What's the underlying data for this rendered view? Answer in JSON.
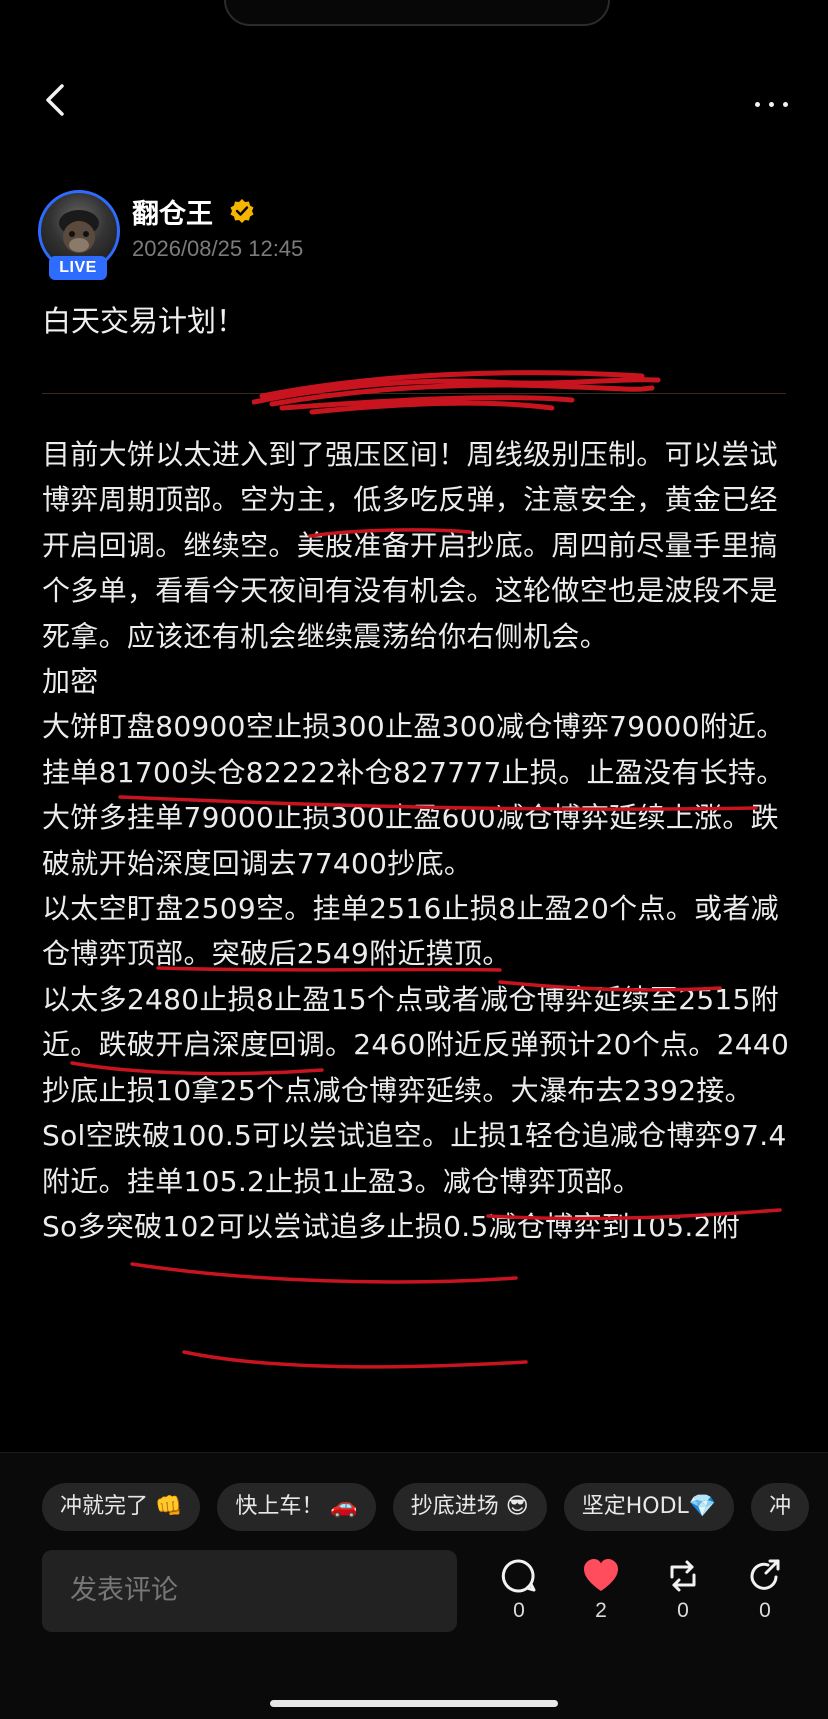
{
  "nav": {
    "back_icon": "chevron-left-icon",
    "more_icon": "more-dots-icon"
  },
  "author": {
    "name": "翻仓王",
    "badge": "LIVE",
    "timestamp": "2026/08/25 12:45",
    "verified_icon": "verified-badge-icon",
    "verified_color": "#f4b400",
    "avatar_ring_color": "#2e6bff"
  },
  "post": {
    "title": "白天交易计划！",
    "paragraphs": [
      "目前大饼以太进入到了强压区间！周线级别压制。可以尝试博弈周期顶部。空为主，低多吃反弹，注意安全，黄金已经开启回调。继续空。美股准备开启抄底。周四前尽量手里搞个多单，看看今天夜间有没有机会。这轮做空也是波段不是死拿。应该还有机会继续震荡给你右侧机会。",
      "加密",
      "大饼盯盘80900空止损300止盈300减仓博弈79000附近。",
      "挂单81700头仓82222补仓827777止损。止盈没有长持。",
      "大饼多挂单79000止损300止盈600减仓博弈延续上涨。跌破就开始深度回调去77400抄底。",
      "以太空盯盘2509空。挂单2516止损8止盈20个点。或者减仓博弈顶部。突破后2549附近摸顶。",
      "以太多2480止损8止盈15个点或者减仓博弈延续至2515附近。跌破开启深度回调。2460附近反弹预计20个点。2440抄底止损10拿25个点减仓博弈延续。大瀑布去2392接。",
      "Sol空跌破100.5可以尝试追空。止损1轻仓追减仓博弈97.4附近。挂单105.2止损1止盈3。减仓博弈顶部。",
      "So多突破102可以尝试追多止损0.5减仓博弈到105.2附"
    ],
    "annotation_color": "#c8141e"
  },
  "quick_replies": [
    "冲就完了 👊",
    "快上车！ 🚗",
    "抄底进场 😎",
    "坚定HODL💎",
    "冲"
  ],
  "comment": {
    "placeholder": "发表评论"
  },
  "actions": [
    {
      "icon": "comment-icon",
      "count": "0"
    },
    {
      "icon": "heart-icon",
      "count": "2",
      "color": "#ff4d5e"
    },
    {
      "icon": "repost-icon",
      "count": "0"
    },
    {
      "icon": "share-icon",
      "count": "0"
    }
  ]
}
